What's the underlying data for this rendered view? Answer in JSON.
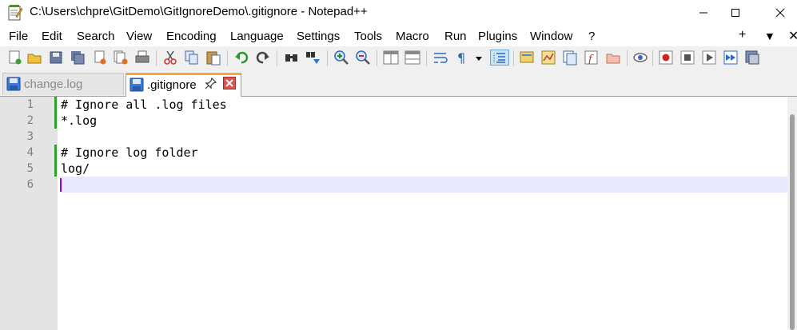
{
  "window": {
    "title": "C:\\Users\\chpre\\GitDemo\\GitIgnoreDemo\\.gitignore - Notepad++",
    "minimize_glyph": "—",
    "maximize_glyph": "☐",
    "close_glyph": "✕"
  },
  "menu": {
    "items": [
      "File",
      "Edit",
      "Search",
      "View",
      "Encoding",
      "Language",
      "Settings",
      "Tools",
      "Macro",
      "Run",
      "Plugins",
      "Window",
      "?"
    ],
    "plus": "+",
    "dropdown": "▼",
    "close": "✕"
  },
  "toolbar": {
    "icons": [
      "new-file-icon",
      "open-file-icon",
      "save-icon",
      "save-all-icon",
      "close-icon",
      "close-all-icon",
      "print-icon",
      "cut-icon",
      "copy-icon",
      "paste-icon",
      "undo-icon",
      "redo-icon",
      "find-icon",
      "replace-icon",
      "zoom-in-icon",
      "zoom-out-icon",
      "sync-vertical-icon",
      "sync-horizontal-icon",
      "word-wrap-icon",
      "show-all-characters-icon",
      "indent-guide-icon",
      "user-defined-language-icon",
      "document-map-icon",
      "document-list-icon",
      "function-list-icon",
      "folder-as-workspace-icon",
      "monitoring-icon",
      "record-macro-icon",
      "stop-recording-icon",
      "playback-macro-icon",
      "run-macro-multiple-icon",
      "save-macro-icon"
    ]
  },
  "tabs": [
    {
      "label": "change.log",
      "active": false
    },
    {
      "label": ".gitignore",
      "active": true,
      "pin_glyph": "⚲",
      "close_glyph": "✕"
    }
  ],
  "editor": {
    "line_numbers": [
      "1",
      "2",
      "3",
      "4",
      "5",
      "6"
    ],
    "lines": [
      "# Ignore all .log files",
      "*.log",
      "",
      "# Ignore log folder",
      "log/",
      ""
    ],
    "current_line": 6
  },
  "colors": {
    "accent_tab": "#f7a73b",
    "change_marker": "#2fa12f",
    "current_line_bg": "#e8e8ff",
    "caret": "#8000ff"
  }
}
